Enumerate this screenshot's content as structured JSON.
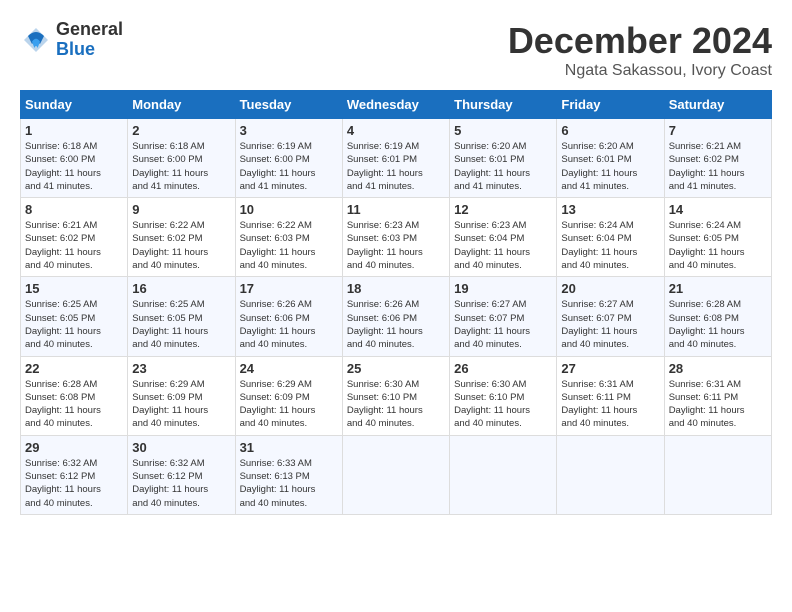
{
  "logo": {
    "general": "General",
    "blue": "Blue"
  },
  "title": "December 2024",
  "location": "Ngata Sakassou, Ivory Coast",
  "days_of_week": [
    "Sunday",
    "Monday",
    "Tuesday",
    "Wednesday",
    "Thursday",
    "Friday",
    "Saturday"
  ],
  "weeks": [
    [
      {
        "day": "1",
        "sunrise": "6:18 AM",
        "sunset": "6:00 PM",
        "daylight": "11 hours and 41 minutes."
      },
      {
        "day": "2",
        "sunrise": "6:18 AM",
        "sunset": "6:00 PM",
        "daylight": "11 hours and 41 minutes."
      },
      {
        "day": "3",
        "sunrise": "6:19 AM",
        "sunset": "6:00 PM",
        "daylight": "11 hours and 41 minutes."
      },
      {
        "day": "4",
        "sunrise": "6:19 AM",
        "sunset": "6:01 PM",
        "daylight": "11 hours and 41 minutes."
      },
      {
        "day": "5",
        "sunrise": "6:20 AM",
        "sunset": "6:01 PM",
        "daylight": "11 hours and 41 minutes."
      },
      {
        "day": "6",
        "sunrise": "6:20 AM",
        "sunset": "6:01 PM",
        "daylight": "11 hours and 41 minutes."
      },
      {
        "day": "7",
        "sunrise": "6:21 AM",
        "sunset": "6:02 PM",
        "daylight": "11 hours and 41 minutes."
      }
    ],
    [
      {
        "day": "8",
        "sunrise": "6:21 AM",
        "sunset": "6:02 PM",
        "daylight": "11 hours and 40 minutes."
      },
      {
        "day": "9",
        "sunrise": "6:22 AM",
        "sunset": "6:02 PM",
        "daylight": "11 hours and 40 minutes."
      },
      {
        "day": "10",
        "sunrise": "6:22 AM",
        "sunset": "6:03 PM",
        "daylight": "11 hours and 40 minutes."
      },
      {
        "day": "11",
        "sunrise": "6:23 AM",
        "sunset": "6:03 PM",
        "daylight": "11 hours and 40 minutes."
      },
      {
        "day": "12",
        "sunrise": "6:23 AM",
        "sunset": "6:04 PM",
        "daylight": "11 hours and 40 minutes."
      },
      {
        "day": "13",
        "sunrise": "6:24 AM",
        "sunset": "6:04 PM",
        "daylight": "11 hours and 40 minutes."
      },
      {
        "day": "14",
        "sunrise": "6:24 AM",
        "sunset": "6:05 PM",
        "daylight": "11 hours and 40 minutes."
      }
    ],
    [
      {
        "day": "15",
        "sunrise": "6:25 AM",
        "sunset": "6:05 PM",
        "daylight": "11 hours and 40 minutes."
      },
      {
        "day": "16",
        "sunrise": "6:25 AM",
        "sunset": "6:05 PM",
        "daylight": "11 hours and 40 minutes."
      },
      {
        "day": "17",
        "sunrise": "6:26 AM",
        "sunset": "6:06 PM",
        "daylight": "11 hours and 40 minutes."
      },
      {
        "day": "18",
        "sunrise": "6:26 AM",
        "sunset": "6:06 PM",
        "daylight": "11 hours and 40 minutes."
      },
      {
        "day": "19",
        "sunrise": "6:27 AM",
        "sunset": "6:07 PM",
        "daylight": "11 hours and 40 minutes."
      },
      {
        "day": "20",
        "sunrise": "6:27 AM",
        "sunset": "6:07 PM",
        "daylight": "11 hours and 40 minutes."
      },
      {
        "day": "21",
        "sunrise": "6:28 AM",
        "sunset": "6:08 PM",
        "daylight": "11 hours and 40 minutes."
      }
    ],
    [
      {
        "day": "22",
        "sunrise": "6:28 AM",
        "sunset": "6:08 PM",
        "daylight": "11 hours and 40 minutes."
      },
      {
        "day": "23",
        "sunrise": "6:29 AM",
        "sunset": "6:09 PM",
        "daylight": "11 hours and 40 minutes."
      },
      {
        "day": "24",
        "sunrise": "6:29 AM",
        "sunset": "6:09 PM",
        "daylight": "11 hours and 40 minutes."
      },
      {
        "day": "25",
        "sunrise": "6:30 AM",
        "sunset": "6:10 PM",
        "daylight": "11 hours and 40 minutes."
      },
      {
        "day": "26",
        "sunrise": "6:30 AM",
        "sunset": "6:10 PM",
        "daylight": "11 hours and 40 minutes."
      },
      {
        "day": "27",
        "sunrise": "6:31 AM",
        "sunset": "6:11 PM",
        "daylight": "11 hours and 40 minutes."
      },
      {
        "day": "28",
        "sunrise": "6:31 AM",
        "sunset": "6:11 PM",
        "daylight": "11 hours and 40 minutes."
      }
    ],
    [
      {
        "day": "29",
        "sunrise": "6:32 AM",
        "sunset": "6:12 PM",
        "daylight": "11 hours and 40 minutes."
      },
      {
        "day": "30",
        "sunrise": "6:32 AM",
        "sunset": "6:12 PM",
        "daylight": "11 hours and 40 minutes."
      },
      {
        "day": "31",
        "sunrise": "6:33 AM",
        "sunset": "6:13 PM",
        "daylight": "11 hours and 40 minutes."
      },
      null,
      null,
      null,
      null
    ]
  ]
}
